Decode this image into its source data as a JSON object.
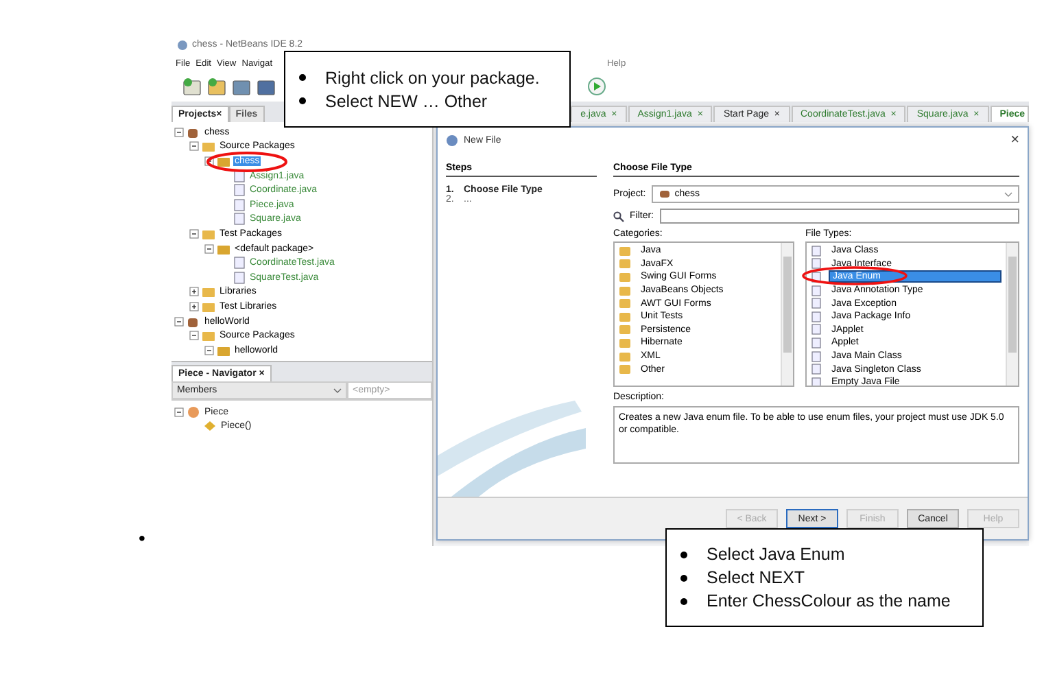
{
  "document": {
    "empty_bullet": "•"
  },
  "ide": {
    "title": "chess - NetBeans IDE 8.2",
    "menu": [
      "File",
      "Edit",
      "View",
      "Navigat",
      "Help"
    ],
    "panel_tabs": [
      {
        "label": "Projects",
        "close": "×",
        "selected": true
      },
      {
        "label": "Files",
        "selected": false
      }
    ],
    "editor_tabs": [
      {
        "label": "e.java",
        "close": "×",
        "selected": false
      },
      {
        "label": "Assign1.java",
        "close": "×",
        "selected": false
      },
      {
        "label": "Start Page",
        "close": "×",
        "selected": false
      },
      {
        "label": "CoordinateTest.java",
        "close": "×",
        "selected": false
      },
      {
        "label": "Square.java",
        "close": "×",
        "selected": false
      },
      {
        "label": "Piece",
        "selected": true
      }
    ],
    "project_tree": [
      {
        "label": "chess",
        "kind": "project",
        "expanded": true,
        "selected": false,
        "color": "#000000",
        "children": [
          {
            "label": "Source Packages",
            "kind": "folder",
            "expanded": true,
            "selected": false,
            "color": "#000000",
            "children": [
              {
                "label": "chess",
                "kind": "package",
                "expanded": true,
                "selected": true,
                "children": [
                  {
                    "label": "Assign1.java",
                    "kind": "file",
                    "selected": false,
                    "color": "#3a8a3a"
                  },
                  {
                    "label": "Coordinate.java",
                    "kind": "file",
                    "selected": false,
                    "color": "#3a8a3a"
                  },
                  {
                    "label": "Piece.java",
                    "kind": "file",
                    "selected": false,
                    "color": "#3a8a3a"
                  },
                  {
                    "label": "Square.java",
                    "kind": "file",
                    "selected": false,
                    "color": "#3a8a3a"
                  }
                ]
              }
            ]
          },
          {
            "label": "Test Packages",
            "kind": "folder",
            "expanded": true,
            "selected": false,
            "color": "#000000",
            "children": [
              {
                "label": "<default package>",
                "kind": "package",
                "expanded": true,
                "selected": false,
                "color": "#000000",
                "children": [
                  {
                    "label": "CoordinateTest.java",
                    "kind": "file",
                    "selected": false,
                    "color": "#3a8a3a"
                  },
                  {
                    "label": "SquareTest.java",
                    "kind": "file",
                    "selected": false,
                    "color": "#3a8a3a"
                  }
                ]
              }
            ]
          },
          {
            "label": "Libraries",
            "kind": "folder",
            "expanded": false,
            "selected": false,
            "color": "#000000"
          },
          {
            "label": "Test Libraries",
            "kind": "folder",
            "expanded": false,
            "selected": false,
            "color": "#000000"
          }
        ]
      },
      {
        "label": "helloWorld",
        "kind": "project",
        "expanded": true,
        "selected": false,
        "color": "#000000",
        "children": [
          {
            "label": "Source Packages",
            "kind": "folder",
            "expanded": true,
            "selected": false,
            "color": "#000000",
            "children": [
              {
                "label": "helloworld",
                "kind": "package",
                "expanded": true,
                "selected": false,
                "color": "#000000"
              }
            ]
          }
        ]
      }
    ],
    "navigator": {
      "title": "Piece - Navigator",
      "close": "×",
      "filter": "Members",
      "empty": "<empty>",
      "tree": [
        {
          "label": "Piece",
          "kind": "class",
          "expanded": true,
          "children": [
            {
              "label": "Piece()",
              "kind": "method"
            }
          ]
        }
      ]
    }
  },
  "dialog": {
    "title": "New File",
    "close": "×",
    "steps_heading": "Steps",
    "steps": [
      {
        "number": "1.",
        "label": "Choose File Type",
        "current": true
      },
      {
        "number": "2.",
        "label": "...",
        "current": false
      }
    ],
    "heading": "Choose File Type",
    "project_label": "Project:",
    "project": "chess",
    "filter_label": "Filter:",
    "categories_label": "Categories:",
    "categories": [
      {
        "label": "Java",
        "selected": false
      },
      {
        "label": "JavaFX",
        "selected": false
      },
      {
        "label": "Swing GUI Forms",
        "selected": false
      },
      {
        "label": "JavaBeans Objects",
        "selected": false
      },
      {
        "label": "AWT GUI Forms",
        "selected": false
      },
      {
        "label": "Unit Tests",
        "selected": false
      },
      {
        "label": "Persistence",
        "selected": false
      },
      {
        "label": "Hibernate",
        "selected": false
      },
      {
        "label": "XML",
        "selected": false
      },
      {
        "label": "Other",
        "selected": false
      }
    ],
    "file_types_label": "File Types:",
    "file_types": [
      {
        "label": "Java Class",
        "selected": false
      },
      {
        "label": "Java Interface",
        "selected": false
      },
      {
        "label": "Java Enum",
        "selected": true
      },
      {
        "label": "Java Annotation Type",
        "selected": false
      },
      {
        "label": "Java Exception",
        "selected": false
      },
      {
        "label": "Java Package Info",
        "selected": false
      },
      {
        "label": "JApplet",
        "selected": false
      },
      {
        "label": "Applet",
        "selected": false
      },
      {
        "label": "Java Main Class",
        "selected": false
      },
      {
        "label": "Java Singleton Class",
        "selected": false
      },
      {
        "label": "Empty Java File",
        "selected": false
      }
    ],
    "description_label": "Description:",
    "description": "Creates a new Java enum file. To be able to use enum files, your project must use JDK 5.0 or compatible.",
    "buttons": [
      {
        "label": "< Back",
        "disabled": true,
        "default": false
      },
      {
        "label": "Next >",
        "disabled": false,
        "default": true
      },
      {
        "label": "Finish",
        "disabled": true,
        "default": false
      },
      {
        "label": "Cancel",
        "disabled": false,
        "default": false
      },
      {
        "label": "Help",
        "disabled": true,
        "default": false
      }
    ]
  },
  "callouts": [
    {
      "items": [
        "Right click on your package.",
        "Select NEW … Other"
      ]
    },
    {
      "items": [
        "Select Java Enum",
        "Select NEXT",
        "Enter ChessColour as the name"
      ]
    }
  ]
}
